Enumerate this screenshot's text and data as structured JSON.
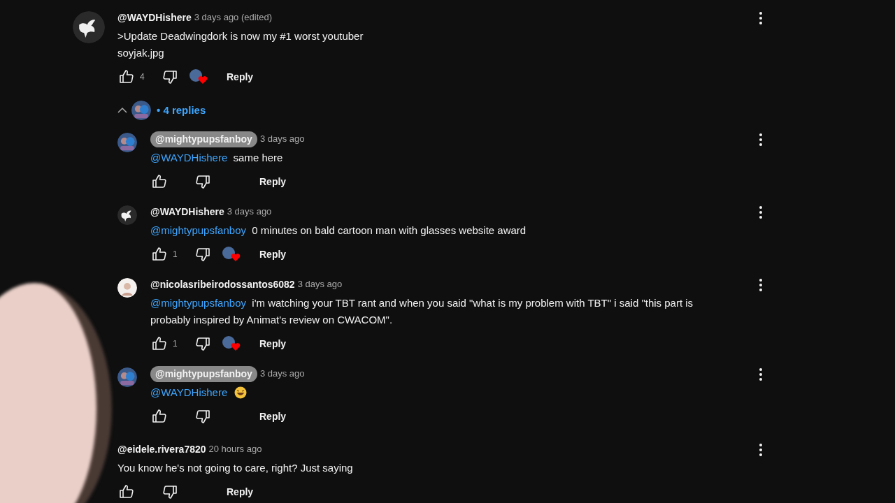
{
  "comments": [
    {
      "avatar": {
        "kind": "bird"
      },
      "author": "@WAYDHishere",
      "author_highlighted": false,
      "time": "3 days ago (edited)",
      "text_lines": [
        ">Update Deadwingdork is now my #1 worst youtuber",
        "soyjak.jpg"
      ],
      "likes": "4",
      "hearted": true,
      "reply_label": "Reply",
      "replies": {
        "label": "• 4 replies",
        "expanded": true,
        "items": [
          {
            "avatar": {
              "kind": "cartoon"
            },
            "author": "@mightypupsfanboy",
            "author_highlighted": true,
            "time": "3 days ago",
            "mention": "@WAYDHishere",
            "text": "same here",
            "hearted": false,
            "reply_label": "Reply"
          },
          {
            "avatar": {
              "kind": "bird"
            },
            "author": "@WAYDHishere",
            "author_highlighted": false,
            "time": "3 days ago",
            "mention": "@mightypupsfanboy",
            "text": "0 minutes on bald cartoon man with glasses website award",
            "likes": "1",
            "hearted": true,
            "reply_label": "Reply"
          },
          {
            "avatar": {
              "kind": "person"
            },
            "author": "@nicolasribeirodossantos6082",
            "author_highlighted": false,
            "time": "3 days ago",
            "mention": "@mightypupsfanboy",
            "text": "i'm watching your TBT rant and when you said \"what is my problem with TBT\" i said \"this part is probably inspired by Animat's review on CWACOM\".",
            "likes": "1",
            "hearted": true,
            "reply_label": "Reply"
          },
          {
            "avatar": {
              "kind": "cartoon"
            },
            "author": "@mightypupsfanboy",
            "author_highlighted": true,
            "time": "3 days ago",
            "mention": "@WAYDHishere",
            "emoji": true,
            "hearted": false,
            "reply_label": "Reply"
          }
        ]
      }
    },
    {
      "author": "@eidele.rivera7820",
      "author_highlighted": false,
      "time": "20 hours ago",
      "text_lines": [
        "You know he's not going to care, right? Just saying"
      ],
      "hearted": false,
      "reply_label": "Reply"
    }
  ]
}
